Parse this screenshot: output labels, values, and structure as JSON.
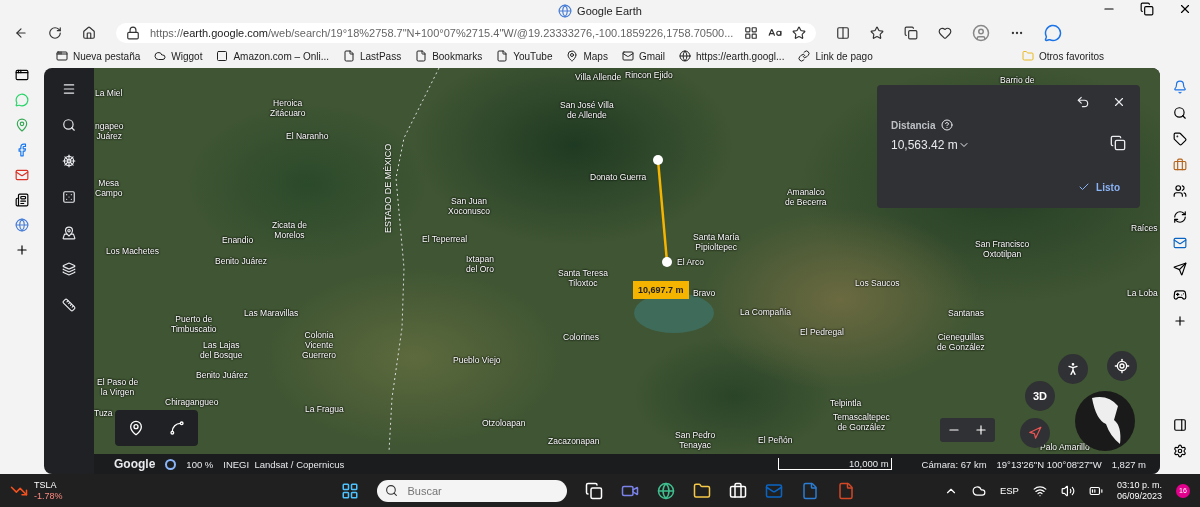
{
  "window": {
    "title": "Google Earth"
  },
  "address_bar": {
    "url": "https://**earth.google.com**/web/search/19°18%2758.7\"N+100°07%2715.4\"W/@19.23333276,-100.1859226,1758.70500..."
  },
  "bookmarks": [
    {
      "label": "Nueva pestaña",
      "kind": "tab"
    },
    {
      "label": "Wiggot",
      "kind": "cloud"
    },
    {
      "label": "Amazon.com – Onli...",
      "kind": "amazon"
    },
    {
      "label": "LastPass",
      "kind": "file"
    },
    {
      "label": "Bookmarks",
      "kind": "file"
    },
    {
      "label": "YouTube",
      "kind": "file"
    },
    {
      "label": "Maps",
      "kind": "maps"
    },
    {
      "label": "Gmail",
      "kind": "gmail"
    },
    {
      "label": "https://earth.googl...",
      "kind": "google"
    },
    {
      "label": "Link de pago",
      "kind": "link"
    }
  ],
  "other_bookmarks": "Otros favoritos",
  "map": {
    "labels": [
      {
        "text": "La Miel"
      },
      {
        "text": "ngapeo\nJuárez"
      },
      {
        "text": "Heroica\nZitácuaro"
      },
      {
        "text": "El Naranho"
      },
      {
        "text": "Mesa\nCampo"
      },
      {
        "text": "Zicata de\nMorelos"
      },
      {
        "text": "Enandio"
      },
      {
        "text": "Los Machetes"
      },
      {
        "text": "Benito Juárez"
      },
      {
        "text": "San Juan\nXoconusco"
      },
      {
        "text": "El Teperreal"
      },
      {
        "text": "Ixtapan\ndel Oro"
      },
      {
        "text": "Las Maravillas"
      },
      {
        "text": "Puerto de\nTimbuscatio"
      },
      {
        "text": "Las Lajas\ndel Bosque"
      },
      {
        "text": "Colonia\nVicente\nGuerrero"
      },
      {
        "text": "Benito Juárez"
      },
      {
        "text": "Pueblo Viejo"
      },
      {
        "text": "El Paso de\nla Virgen"
      },
      {
        "text": "Chiragangueo"
      },
      {
        "text": "La Fragua"
      },
      {
        "text": "Tuza"
      },
      {
        "text": "Otzoloapan"
      },
      {
        "text": "Villa Allende"
      },
      {
        "text": "Rincon Ejido"
      },
      {
        "text": "San José Villa\nde Allende"
      },
      {
        "text": "Donato Guerra"
      },
      {
        "text": "Santa Teresa\nTiloxtoc"
      },
      {
        "text": "Colorines"
      },
      {
        "text": "Amanalco\nde Becerra"
      },
      {
        "text": "Santa María\nPipioltepec"
      },
      {
        "text": "El Arco"
      },
      {
        "text": "Bravo"
      },
      {
        "text": "La Compañía"
      },
      {
        "text": "El Pedregal"
      },
      {
        "text": "Los Saucos"
      },
      {
        "text": "Barrio de"
      },
      {
        "text": "San Francisco\nOxtotilpan"
      },
      {
        "text": "Santanas"
      },
      {
        "text": "Cieneguillas\nde González"
      },
      {
        "text": "La Loba"
      },
      {
        "text": "Raíces"
      },
      {
        "text": "Telpintla"
      },
      {
        "text": "Temascaltepec\nde González"
      },
      {
        "text": "Zacazonapan"
      },
      {
        "text": "San Pedro\nTenayac"
      },
      {
        "text": "El Peñón"
      },
      {
        "text": "Palo Amarillo"
      }
    ],
    "boundary_label": "ESTADO DE MÉXICO",
    "measure_tag": "10,697.7 m"
  },
  "measure_panel": {
    "title": "Distancia",
    "value": "10,563.42 m",
    "done": "Listo"
  },
  "view_button": "3D",
  "footer": {
    "brand": "Google",
    "zoom": "100 %",
    "attribution": "INEGI  Landsat / Copernicus",
    "scale": "10,000 m",
    "camera": "Cámara: 67 km",
    "coords": "19°13'26\"N 100°08'27\"W",
    "elevation": "1,827 m"
  },
  "taskbar": {
    "ticker": "TSLA",
    "change": "-1.78%",
    "search_placeholder": "Buscar",
    "language": "ESP",
    "time": "03:10 p. m.",
    "date": "06/09/2023",
    "notifications": "16"
  }
}
